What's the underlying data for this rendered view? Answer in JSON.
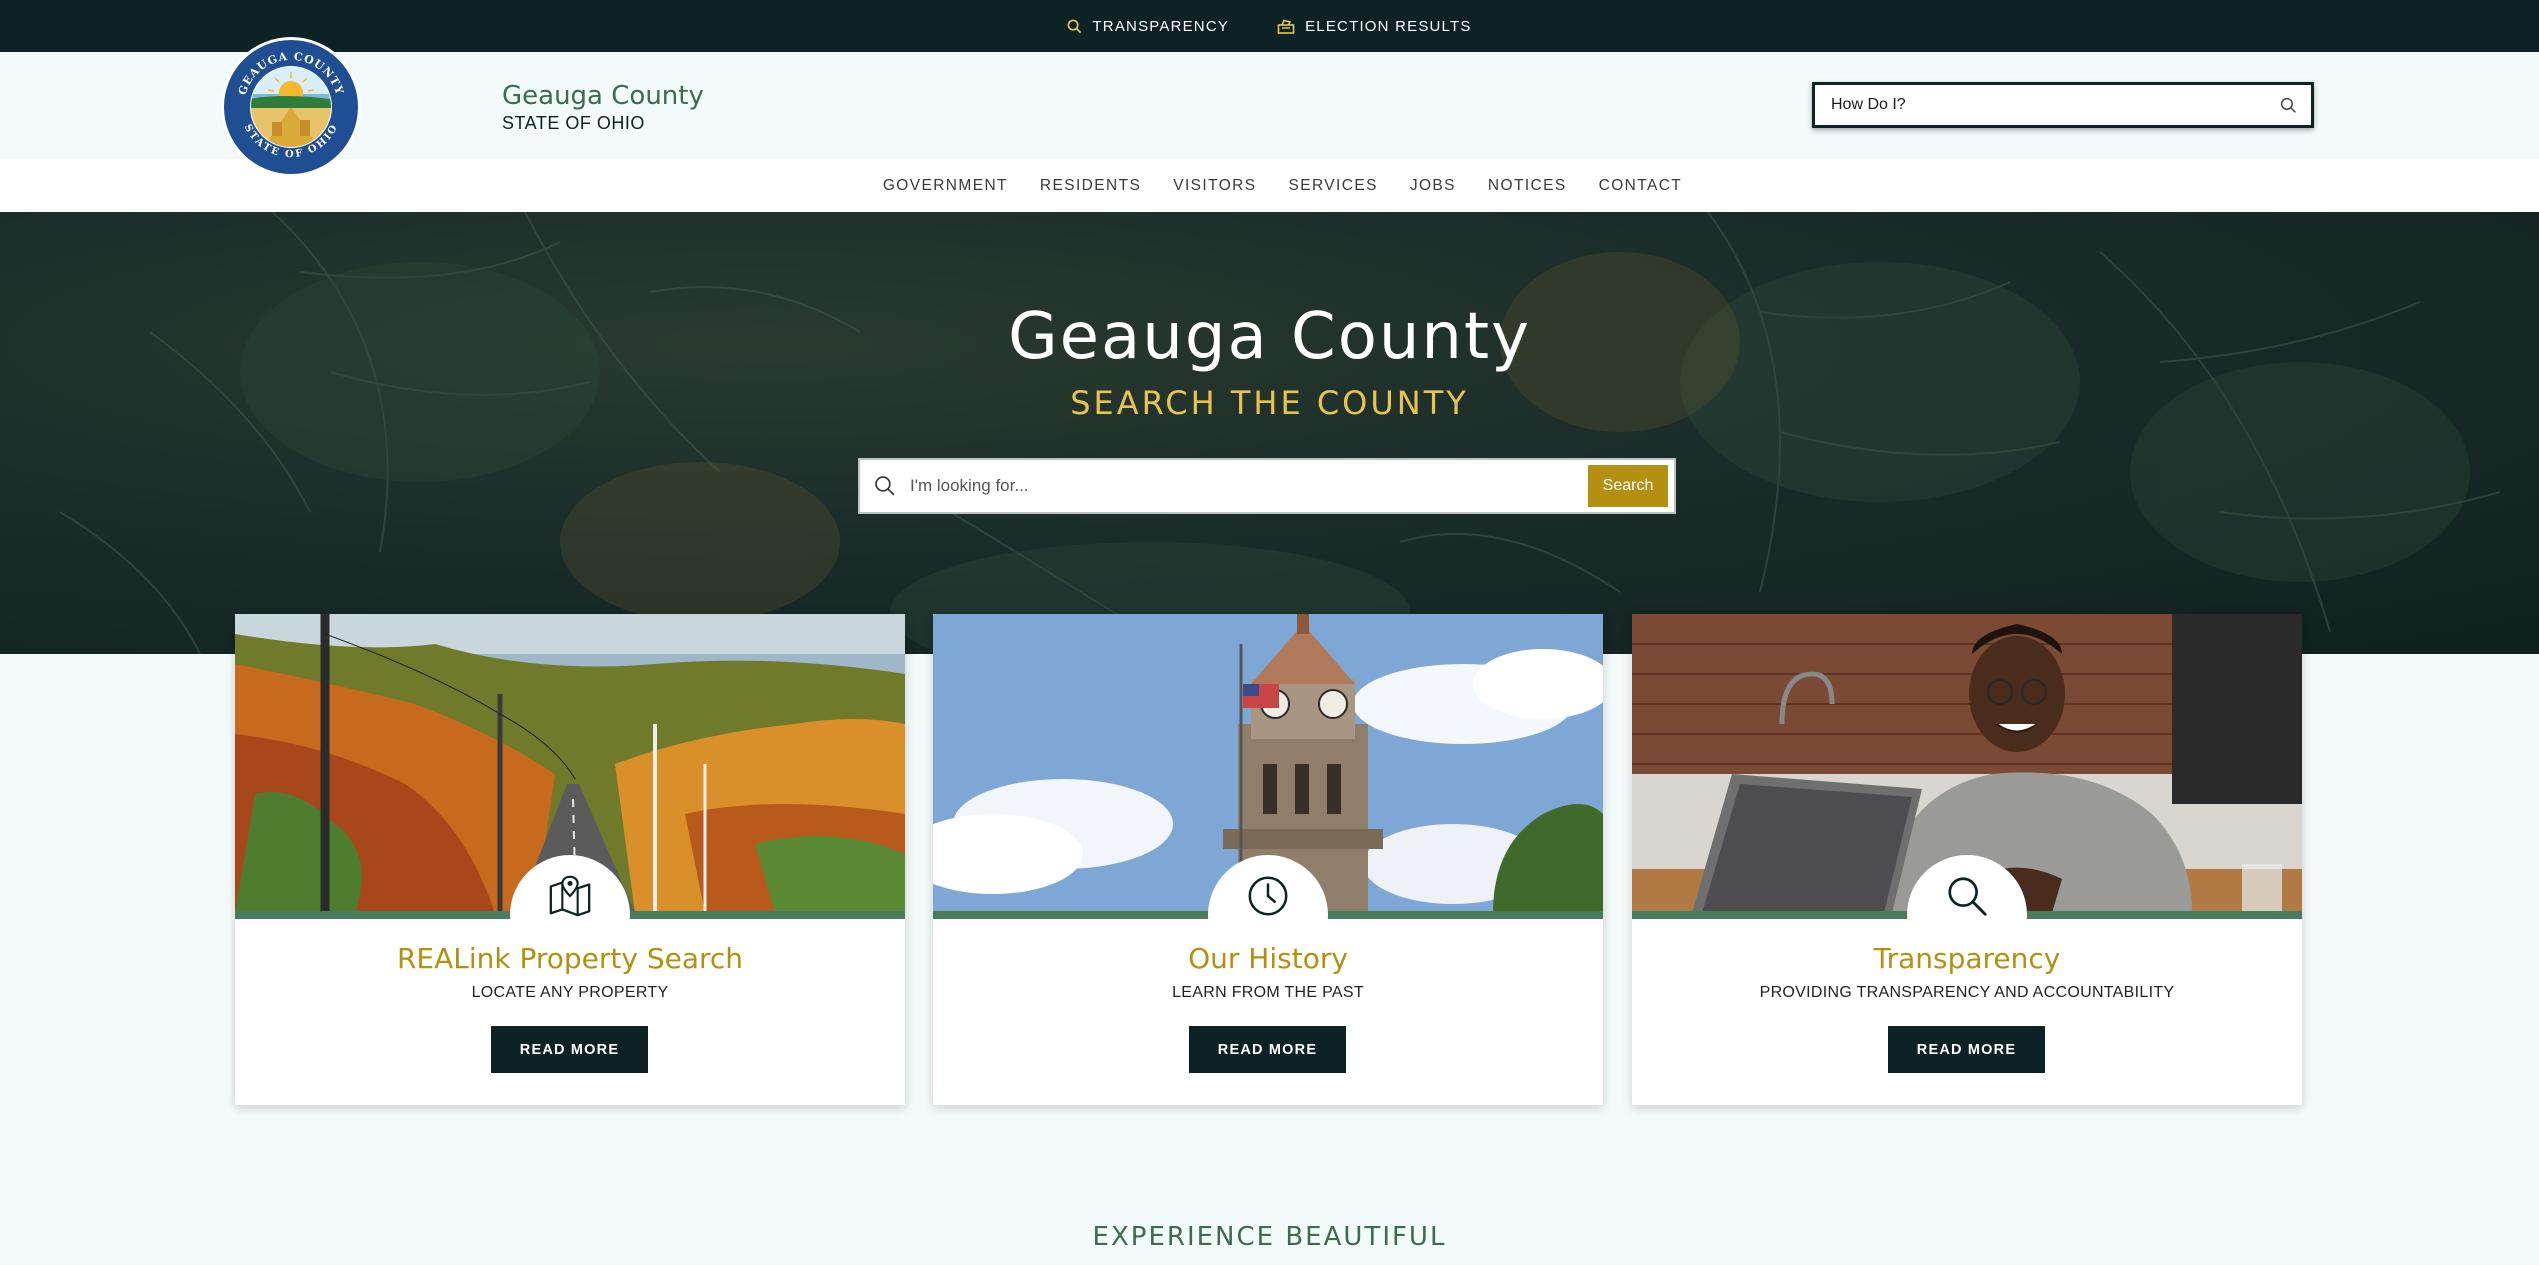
{
  "utility_bar": {
    "transparency": "TRANSPARENCY",
    "election_results": "ELECTION RESULTS"
  },
  "header": {
    "seal_text_top": "GEAUGA COUNTY",
    "seal_text_bottom": "STATE OF OHIO",
    "site_name": "Geauga County",
    "site_state": "STATE OF OHIO",
    "how_do_i": "How Do I?"
  },
  "nav": {
    "items": [
      "GOVERNMENT",
      "RESIDENTS",
      "VISITORS",
      "SERVICES",
      "JOBS",
      "NOTICES",
      "CONTACT"
    ]
  },
  "hero": {
    "title": "Geauga County",
    "subtitle": "SEARCH THE COUNTY",
    "search_placeholder": "I'm looking for...",
    "search_button": "Search"
  },
  "cards": [
    {
      "icon": "map-pin-icon",
      "title": "REALink Property Search",
      "subtitle": "LOCATE ANY PROPERTY",
      "button": "READ MORE"
    },
    {
      "icon": "clock-icon",
      "title": "Our History",
      "subtitle": "LEARN FROM THE PAST",
      "button": "READ MORE"
    },
    {
      "icon": "search-icon",
      "title": "Transparency",
      "subtitle": "PROVIDING TRANSPARENCY AND ACCOUNTABILITY",
      "button": "READ MORE"
    }
  ],
  "section": {
    "experience_heading": "EXPERIENCE BEAUTIFUL"
  },
  "colors": {
    "dark": "#0c2224",
    "green": "#3c6b4d",
    "gold": "#b58f11",
    "hero_gold": "#e8c44d",
    "page_bg": "#f3fbfa"
  }
}
